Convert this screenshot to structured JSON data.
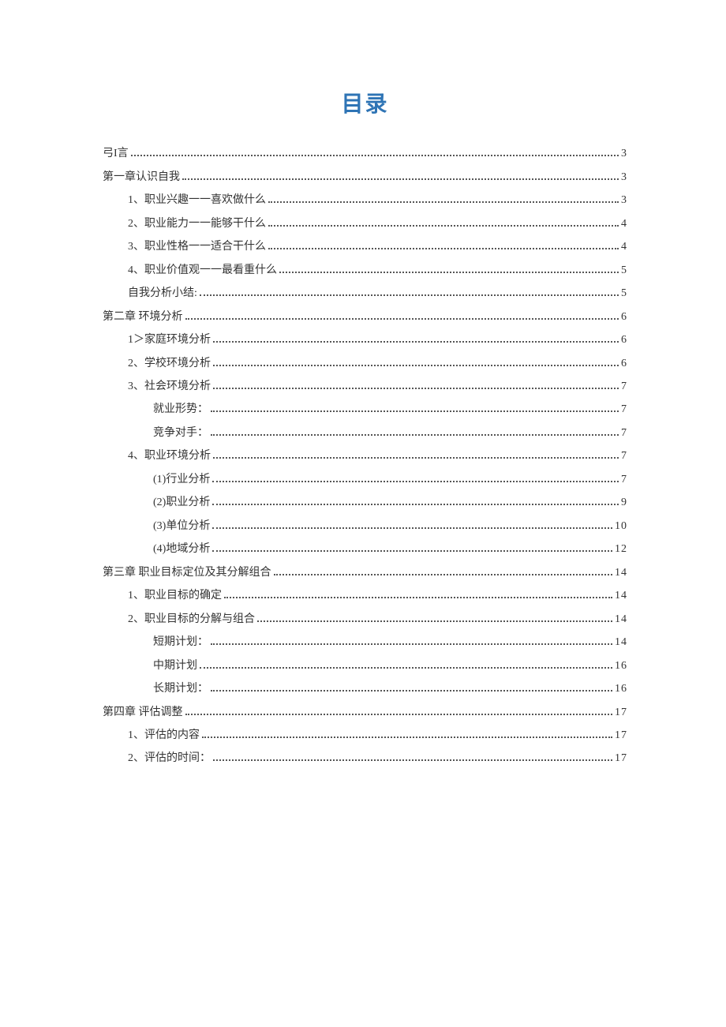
{
  "title": "目录",
  "entries": [
    {
      "text": "弓I言",
      "page": "3",
      "indent": 0
    },
    {
      "text": "第一章认识自我",
      "page": "3",
      "indent": 0
    },
    {
      "text": "1、职业兴趣一一喜欢做什么",
      "page": "3",
      "indent": 1
    },
    {
      "text": "2、职业能力一一能够干什么",
      "page": "4",
      "indent": 1
    },
    {
      "text": "3、职业性格一一适合干什么",
      "page": "4",
      "indent": 1
    },
    {
      "text": "4、职业价值观一一最看重什么",
      "page": "5",
      "indent": 1
    },
    {
      "text": "自我分析小结:",
      "page": "5",
      "indent": 1
    },
    {
      "text": "第二章 环境分析",
      "page": "6",
      "indent": 0
    },
    {
      "text": "1＞家庭环境分析",
      "page": "6",
      "indent": 1
    },
    {
      "text": "2、学校环境分析",
      "page": "6",
      "indent": 1
    },
    {
      "text": "3、社会环境分析",
      "page": "7",
      "indent": 1
    },
    {
      "text": "就业形势：",
      "page": "7",
      "indent": 2
    },
    {
      "text": "竞争对手：",
      "page": "7",
      "indent": 2
    },
    {
      "text": "4、职业环境分析",
      "page": "7",
      "indent": 1
    },
    {
      "text": "(1)行业分析",
      "page": "7",
      "indent": 2
    },
    {
      "text": "(2)职业分析",
      "page": "9",
      "indent": 2
    },
    {
      "text": "(3)单位分析",
      "page": "10",
      "indent": 2
    },
    {
      "text": "(4)地域分析",
      "page": "12",
      "indent": 2
    },
    {
      "text": "第三章 职业目标定位及其分解组合",
      "page": "14",
      "indent": 0
    },
    {
      "text": "1、职业目标的确定",
      "page": "14",
      "indent": 1
    },
    {
      "text": "2、职业目标的分解与组合",
      "page": "14",
      "indent": 1
    },
    {
      "text": "短期计划：",
      "page": "14",
      "indent": 2
    },
    {
      "text": "中期计划",
      "page": "16",
      "indent": 2
    },
    {
      "text": "长期计划：",
      "page": "16",
      "indent": 2
    },
    {
      "text": "第四章 评估调整",
      "page": "17",
      "indent": 0
    },
    {
      "text": "1、评估的内容",
      "page": "17",
      "indent": 1
    },
    {
      "text": "2、评估的时间：",
      "page": "17",
      "indent": 1
    }
  ]
}
